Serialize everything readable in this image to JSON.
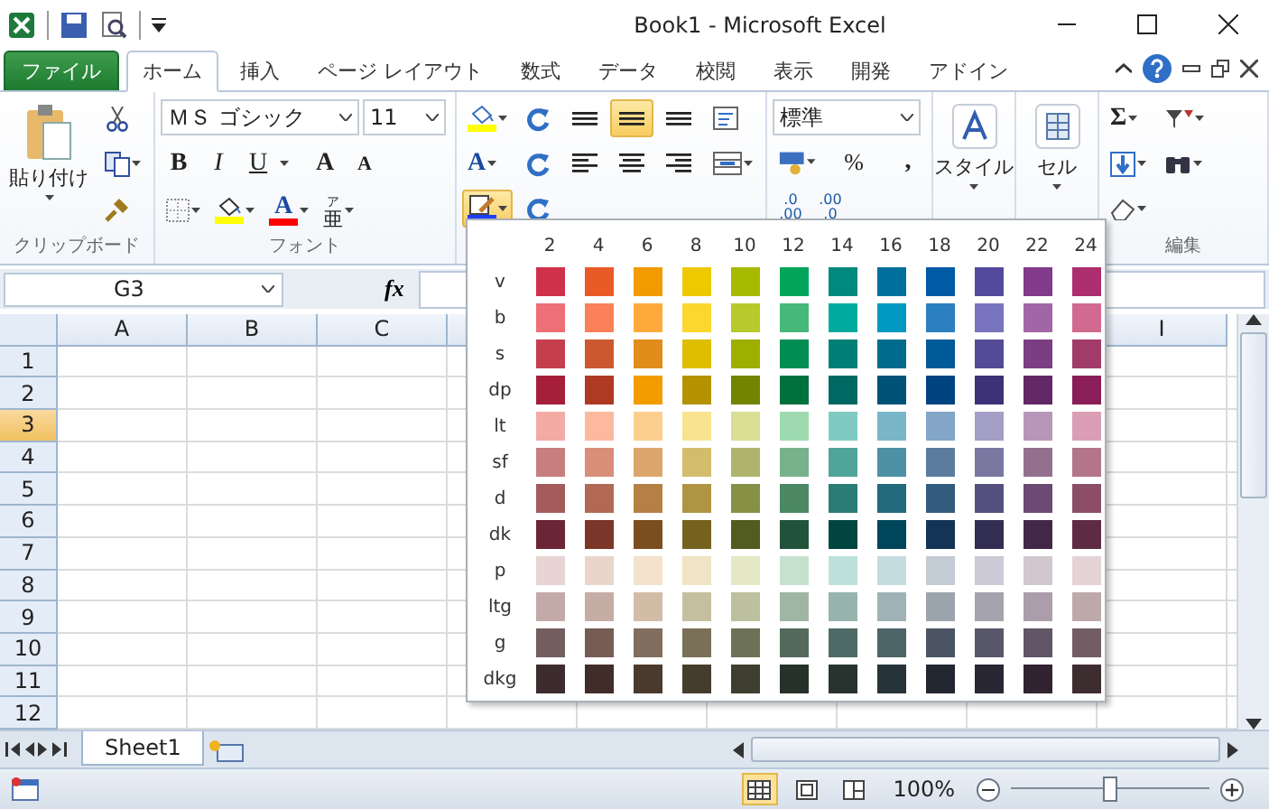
{
  "window": {
    "title": "Book1 - Microsoft Excel"
  },
  "ribbon_tabs": [
    {
      "label": "ファイル",
      "kind": "file",
      "selected": false
    },
    {
      "label": "ホーム",
      "kind": "tab",
      "selected": true
    },
    {
      "label": "挿入",
      "kind": "tab",
      "selected": false
    },
    {
      "label": "ページ レイアウト",
      "kind": "tab",
      "selected": false
    },
    {
      "label": "数式",
      "kind": "tab",
      "selected": false
    },
    {
      "label": "データ",
      "kind": "tab",
      "selected": false
    },
    {
      "label": "校閲",
      "kind": "tab",
      "selected": false
    },
    {
      "label": "表示",
      "kind": "tab",
      "selected": false
    },
    {
      "label": "開発",
      "kind": "tab",
      "selected": false
    },
    {
      "label": "アドイン",
      "kind": "tab",
      "selected": false
    }
  ],
  "clipboard": {
    "paste": "貼り付け",
    "label": "クリップボード"
  },
  "font": {
    "name": "ＭＳ ゴシック",
    "size": "11",
    "bold": "B",
    "italic": "I",
    "underline": "U",
    "grow": "A",
    "shrink": "A",
    "font_color_glyph": "A",
    "phonetic_ruby": "ア",
    "phonetic": "亜",
    "label": "フォント"
  },
  "color_tools": {
    "text_glyph": "A",
    "line_open": true
  },
  "alignment": [
    {
      "kind": "top",
      "selected": false
    },
    {
      "kind": "middle",
      "selected": true
    },
    {
      "kind": "bottom",
      "selected": false
    },
    {
      "kind": "left",
      "selected": false
    },
    {
      "kind": "center",
      "selected": false
    },
    {
      "kind": "right",
      "selected": false
    }
  ],
  "number": {
    "format": "標準",
    "percent": "%",
    "comma": ",",
    "increase": [
      ".0",
      ".00"
    ],
    "decrease": [
      ".00",
      ".0"
    ]
  },
  "styles": {
    "label": "スタイル"
  },
  "cells": {
    "label": "セル"
  },
  "editing": {
    "sum": "Σ",
    "label": "編集"
  },
  "formula_bar": {
    "name_box": "G3",
    "fx": "fx"
  },
  "sheet": {
    "columns": [
      "A",
      "B",
      "C",
      "I"
    ],
    "rows": [
      {
        "label": "1",
        "selected": false
      },
      {
        "label": "2",
        "selected": false
      },
      {
        "label": "3",
        "selected": true
      },
      {
        "label": "4",
        "selected": false
      },
      {
        "label": "5",
        "selected": false
      },
      {
        "label": "6",
        "selected": false
      },
      {
        "label": "7",
        "selected": false
      },
      {
        "label": "8",
        "selected": false
      },
      {
        "label": "9",
        "selected": false
      },
      {
        "label": "10",
        "selected": false
      },
      {
        "label": "11",
        "selected": false
      },
      {
        "label": "12",
        "selected": false
      }
    ]
  },
  "sheet_tabs": [
    {
      "label": "Sheet1",
      "selected": true
    }
  ],
  "status_bar": {
    "zoom": "100%",
    "zoom_slider": {
      "level": 0.5
    }
  },
  "palette": {
    "columns": [
      "2",
      "4",
      "6",
      "8",
      "10",
      "12",
      "14",
      "16",
      "18",
      "20",
      "22",
      "24"
    ],
    "rows": [
      {
        "label": "v",
        "swatches": [
          {
            "color": "#d0314a"
          },
          {
            "color": "#ea5a27"
          },
          {
            "color": "#f29b00"
          },
          {
            "color": "#eec900"
          },
          {
            "color": "#a8ba00"
          },
          {
            "color": "#00a55a"
          },
          {
            "color": "#008a7e"
          },
          {
            "color": "#006f9d"
          },
          {
            "color": "#005aa5"
          },
          {
            "color": "#544a9d"
          },
          {
            "color": "#823a8a"
          },
          {
            "color": "#ad2e6e"
          }
        ]
      },
      {
        "label": "b",
        "swatches": [
          {
            "color": "#ee6f76"
          },
          {
            "color": "#fa8159"
          },
          {
            "color": "#fdaa3a"
          },
          {
            "color": "#fbd72f"
          },
          {
            "color": "#b8c92b"
          },
          {
            "color": "#45b87a"
          },
          {
            "color": "#00aa9d"
          },
          {
            "color": "#0099c1"
          },
          {
            "color": "#2b80c2"
          },
          {
            "color": "#7874bd"
          },
          {
            "color": "#a166a5"
          },
          {
            "color": "#d26a90"
          }
        ]
      },
      {
        "label": "s",
        "swatches": [
          {
            "color": "#c53e4e"
          },
          {
            "color": "#cc582f"
          },
          {
            "color": "#e08d1b"
          },
          {
            "color": "#dfbe00"
          },
          {
            "color": "#9eaf00"
          },
          {
            "color": "#008e53"
          },
          {
            "color": "#007f77"
          },
          {
            "color": "#006b8c"
          },
          {
            "color": "#005a98"
          },
          {
            "color": "#534b95"
          },
          {
            "color": "#7b3e82"
          },
          {
            "color": "#a13c6a"
          }
        ]
      },
      {
        "label": "dp",
        "swatches": [
          {
            "color": "#a61f3a"
          },
          {
            "color": "#ae3a21"
          },
          {
            "color": "#f29c00"
          },
          {
            "color": "#b59300"
          },
          {
            "color": "#738400"
          },
          {
            "color": "#00713d"
          },
          {
            "color": "#006862"
          },
          {
            "color": "#005276"
          },
          {
            "color": "#004381"
          },
          {
            "color": "#3d3278"
          },
          {
            "color": "#622865"
          },
          {
            "color": "#8a1e59"
          }
        ]
      },
      {
        "label": "lt",
        "swatches": [
          {
            "color": "#f4aaa5"
          },
          {
            "color": "#fdb99e"
          },
          {
            "color": "#fdcf8f"
          },
          {
            "color": "#f9e38f"
          },
          {
            "color": "#d9de95"
          },
          {
            "color": "#9ddab0"
          },
          {
            "color": "#7fcbc1"
          },
          {
            "color": "#7ab6c9"
          },
          {
            "color": "#82a5c8"
          },
          {
            "color": "#a39fc6"
          },
          {
            "color": "#b896b9"
          },
          {
            "color": "#da9fb4"
          }
        ]
      },
      {
        "label": "sf",
        "swatches": [
          {
            "color": "#c87d7e"
          },
          {
            "color": "#d98e78"
          },
          {
            "color": "#dba66c"
          },
          {
            "color": "#d3bd6c"
          },
          {
            "color": "#aeb46c"
          },
          {
            "color": "#77b28a"
          },
          {
            "color": "#50a59a"
          },
          {
            "color": "#4e90a4"
          },
          {
            "color": "#5c7c9e"
          },
          {
            "color": "#7a77a1"
          },
          {
            "color": "#94708f"
          },
          {
            "color": "#b3758a"
          }
        ]
      },
      {
        "label": "d",
        "swatches": [
          {
            "color": "#a55a5c"
          },
          {
            "color": "#b16854"
          },
          {
            "color": "#b58044"
          },
          {
            "color": "#ad9544"
          },
          {
            "color": "#879145"
          },
          {
            "color": "#4c8864"
          },
          {
            "color": "#2a7d74"
          },
          {
            "color": "#236a7d"
          },
          {
            "color": "#335b7e"
          },
          {
            "color": "#54507e"
          },
          {
            "color": "#6b4a73"
          },
          {
            "color": "#8c4e66"
          }
        ]
      },
      {
        "label": "dk",
        "swatches": [
          {
            "color": "#6b2535"
          },
          {
            "color": "#7a3628"
          },
          {
            "color": "#7b4e20"
          },
          {
            "color": "#75621f"
          },
          {
            "color": "#525c20"
          },
          {
            "color": "#20533a"
          },
          {
            "color": "#00463f"
          },
          {
            "color": "#00465a"
          },
          {
            "color": "#133455"
          },
          {
            "color": "#322e51"
          },
          {
            "color": "#422848"
          },
          {
            "color": "#5e2b45"
          }
        ]
      },
      {
        "label": "p",
        "swatches": [
          {
            "color": "#e8d4d2"
          },
          {
            "color": "#ead5cd"
          },
          {
            "color": "#f4e2cc"
          },
          {
            "color": "#efe5c4"
          },
          {
            "color": "#e4e8c4"
          },
          {
            "color": "#c6e1ce"
          },
          {
            "color": "#bde0da"
          },
          {
            "color": "#c4dce0"
          },
          {
            "color": "#c3ccd4"
          },
          {
            "color": "#cbcad6"
          },
          {
            "color": "#d2c7ce"
          },
          {
            "color": "#e4d3d6"
          }
        ]
      },
      {
        "label": "ltg",
        "swatches": [
          {
            "color": "#c3aaa8"
          },
          {
            "color": "#c4ada5"
          },
          {
            "color": "#d2bca6"
          },
          {
            "color": "#c6bf9f"
          },
          {
            "color": "#bdc09e"
          },
          {
            "color": "#9fb6a4"
          },
          {
            "color": "#97b4ae"
          },
          {
            "color": "#9fb3b6"
          },
          {
            "color": "#9ba4ad"
          },
          {
            "color": "#a4a3ae"
          },
          {
            "color": "#ab9daa"
          },
          {
            "color": "#bda9aa"
          }
        ]
      },
      {
        "label": "g",
        "swatches": [
          {
            "color": "#745e5d"
          },
          {
            "color": "#775c55"
          },
          {
            "color": "#826e5e"
          },
          {
            "color": "#7a7057"
          },
          {
            "color": "#6d7257"
          },
          {
            "color": "#536a5a"
          },
          {
            "color": "#4e6a66"
          },
          {
            "color": "#4d6569"
          },
          {
            "color": "#4a5463"
          },
          {
            "color": "#585669"
          },
          {
            "color": "#615566"
          },
          {
            "color": "#735d64"
          }
        ]
      },
      {
        "label": "dkg",
        "swatches": [
          {
            "color": "#3d2c2e"
          },
          {
            "color": "#402c29"
          },
          {
            "color": "#4a3a2e"
          },
          {
            "color": "#463c2e"
          },
          {
            "color": "#3e3f30"
          },
          {
            "color": "#263129"
          },
          {
            "color": "#27332f"
          },
          {
            "color": "#26343a"
          },
          {
            "color": "#212631"
          },
          {
            "color": "#292734"
          },
          {
            "color": "#31232f"
          },
          {
            "color": "#3d2d31"
          }
        ]
      }
    ]
  }
}
